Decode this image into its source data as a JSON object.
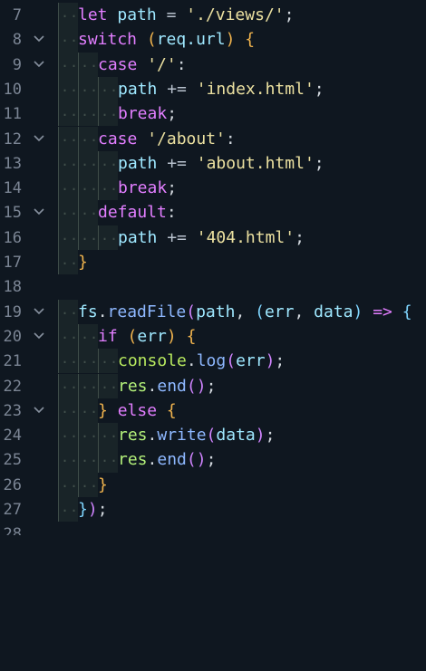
{
  "editor": {
    "language": "javascript",
    "theme": "dark",
    "lines": [
      {
        "no": "7",
        "fold": false,
        "code": "let path = './views/';"
      },
      {
        "no": "8",
        "fold": true,
        "code": "switch (req.url) {"
      },
      {
        "no": "9",
        "fold": true,
        "code": "case '/':"
      },
      {
        "no": "10",
        "fold": false,
        "code": "path += 'index.html';"
      },
      {
        "no": "11",
        "fold": false,
        "code": "break;"
      },
      {
        "no": "12",
        "fold": true,
        "code": "case '/about':"
      },
      {
        "no": "13",
        "fold": false,
        "code": "path += 'about.html';"
      },
      {
        "no": "14",
        "fold": false,
        "code": "break;"
      },
      {
        "no": "15",
        "fold": true,
        "code": "default:"
      },
      {
        "no": "16",
        "fold": false,
        "code": "path += '404.html';"
      },
      {
        "no": "17",
        "fold": false,
        "code": "}"
      },
      {
        "no": "18",
        "fold": false,
        "code": ""
      },
      {
        "no": "19",
        "fold": true,
        "code": "fs.readFile(path, (err, data) => {"
      },
      {
        "no": "20",
        "fold": true,
        "code": "if (err) {"
      },
      {
        "no": "21",
        "fold": false,
        "code": "console.log(err);"
      },
      {
        "no": "22",
        "fold": false,
        "code": "res.end();"
      },
      {
        "no": "23",
        "fold": true,
        "code": "} else {"
      },
      {
        "no": "24",
        "fold": false,
        "code": "res.write(data);"
      },
      {
        "no": "25",
        "fold": false,
        "code": "res.end();"
      },
      {
        "no": "26",
        "fold": false,
        "code": "}"
      },
      {
        "no": "27",
        "fold": false,
        "code": "});"
      },
      {
        "no": "28",
        "fold": false,
        "code": ""
      }
    ]
  }
}
